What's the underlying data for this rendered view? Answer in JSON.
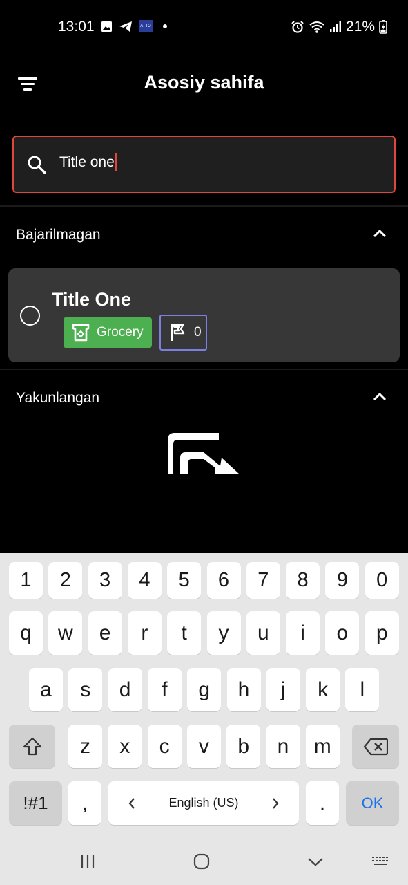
{
  "status_bar": {
    "time": "13:01",
    "battery": "21%",
    "icons_left": [
      "image-icon",
      "telegram-icon",
      "atto-icon",
      "dot-icon"
    ],
    "icons_right": [
      "alarm-icon",
      "wifi-icon",
      "signal-icon",
      "battery-icon"
    ]
  },
  "header": {
    "title": "Asosiy sahifa",
    "menu_icon": "filter-menu-icon"
  },
  "search": {
    "value": "Title one",
    "icon": "search-icon"
  },
  "sections": [
    {
      "title": "Bajarilmagan",
      "expanded": true
    },
    {
      "title": "Yakunlangan",
      "expanded": true
    }
  ],
  "tasks": [
    {
      "title": "Title One",
      "category": "Grocery",
      "category_color": "#4caf50",
      "priority": "0",
      "priority_border": "#7b7fe0"
    }
  ],
  "keyboard": {
    "row_numbers": [
      "1",
      "2",
      "3",
      "4",
      "5",
      "6",
      "7",
      "8",
      "9",
      "0"
    ],
    "row1": [
      "q",
      "w",
      "e",
      "r",
      "t",
      "y",
      "u",
      "i",
      "o",
      "p"
    ],
    "row2": [
      "a",
      "s",
      "d",
      "f",
      "g",
      "h",
      "j",
      "k",
      "l"
    ],
    "row3": [
      "z",
      "x",
      "c",
      "v",
      "b",
      "n",
      "m"
    ],
    "symbols_label": "!#1",
    "comma": ",",
    "language": "English (US)",
    "period": ".",
    "ok_label": "OK",
    "accent": "#1a73e8"
  },
  "colors": {
    "search_border": "#e0463a",
    "card_bg": "#373737"
  }
}
